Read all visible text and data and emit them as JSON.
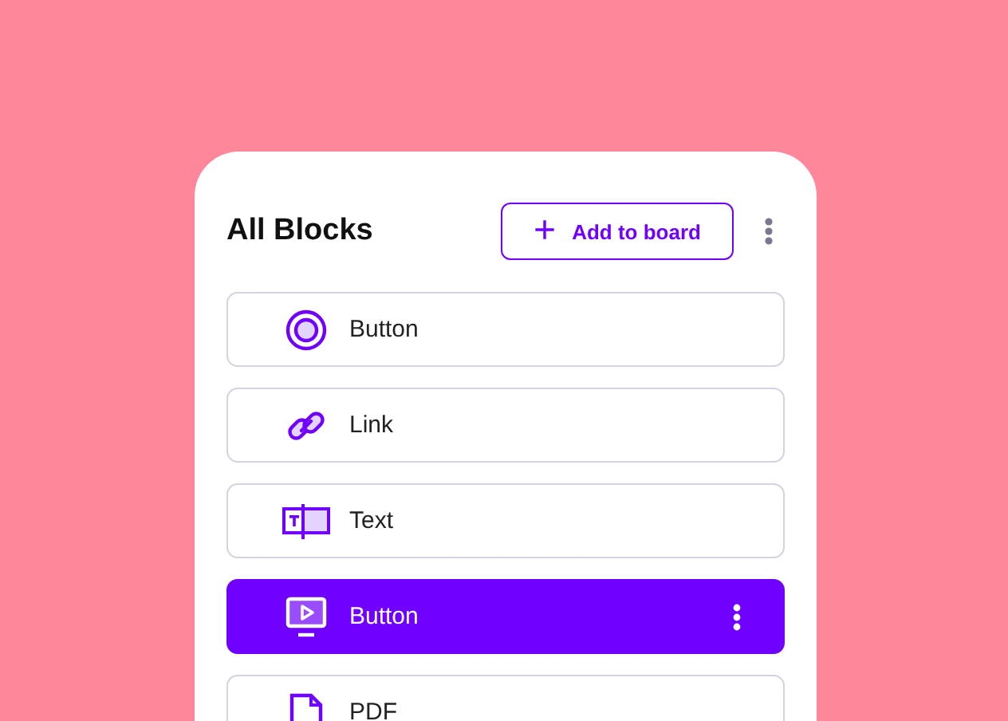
{
  "panel": {
    "title": "All Blocks",
    "add_button": {
      "icon": "+",
      "label": "Add to board"
    }
  },
  "blocks": [
    {
      "kind": "target",
      "label": "Button",
      "selected": false
    },
    {
      "kind": "link",
      "label": "Link",
      "selected": false
    },
    {
      "kind": "text",
      "label": "Text",
      "selected": false
    },
    {
      "kind": "video",
      "label": "Button",
      "selected": true
    },
    {
      "kind": "file",
      "label": "PDF",
      "selected": false
    }
  ]
}
